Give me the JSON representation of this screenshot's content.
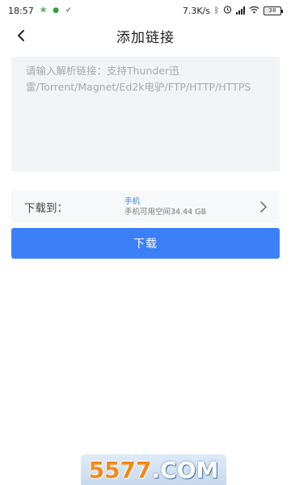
{
  "status_bar": {
    "time": "18:57",
    "network_speed": "7.3K/s",
    "battery": "38",
    "battery_level": 0.38,
    "icons": [
      "wechat-notification-icon",
      "android-notification-icon",
      "bluetooth-icon",
      "alarm-icon",
      "signal-icon",
      "wifi-icon",
      "battery-icon"
    ]
  },
  "header": {
    "title": "添加链接",
    "back_icon": "back-arrow-icon"
  },
  "link_input": {
    "value": "",
    "placeholder": "请输入解析链接：支持Thunder迅雷/Torrent/Magnet/Ed2k电驴/FTP/HTTP/HTTPS"
  },
  "download_location": {
    "label": "下载到：",
    "device": "手机",
    "free_space": "手机可用空间34.44 GB",
    "chevron_icon": "chevron-right-icon"
  },
  "download_button": {
    "label": "下载"
  },
  "watermark": {
    "text_number": "5577",
    "text_domain": ".COM"
  },
  "colors": {
    "accent": "#3b80f7",
    "input_bg": "#f2f3f5",
    "device_text": "#3b7ff5"
  }
}
